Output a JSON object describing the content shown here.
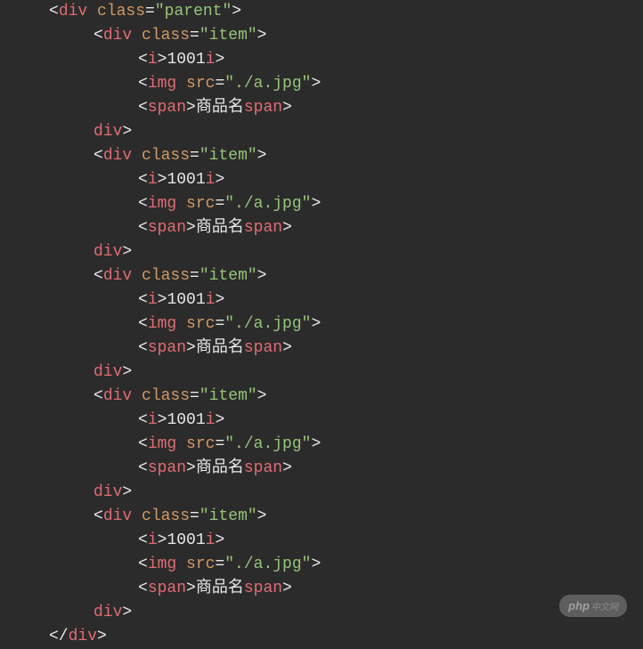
{
  "code": {
    "parent": {
      "tag": "div",
      "class": "parent",
      "items": [
        {
          "tag": "div",
          "class": "item",
          "i_value": "1001",
          "img_src": "./a.jpg",
          "span_text": "商品名"
        },
        {
          "tag": "div",
          "class": "item",
          "i_value": "1001",
          "img_src": "./a.jpg",
          "span_text": "商品名"
        },
        {
          "tag": "div",
          "class": "item",
          "i_value": "1001",
          "img_src": "./a.jpg",
          "span_text": "商品名"
        },
        {
          "tag": "div",
          "class": "item",
          "i_value": "1001",
          "img_src": "./a.jpg",
          "span_text": "商品名"
        },
        {
          "tag": "div",
          "class": "item",
          "i_value": "1001",
          "img_src": "./a.jpg",
          "span_text": "商品名"
        }
      ]
    }
  },
  "tokens": {
    "lt": "<",
    "gt": ">",
    "lt_slash": "</",
    "eq": "=",
    "quote": "\"",
    "class_attr": "class",
    "src_attr": "src",
    "div_tag": "div",
    "i_tag": "i",
    "img_tag": "img",
    "span_tag": "span"
  },
  "watermark": {
    "main": "php",
    "sub": "中文网"
  }
}
